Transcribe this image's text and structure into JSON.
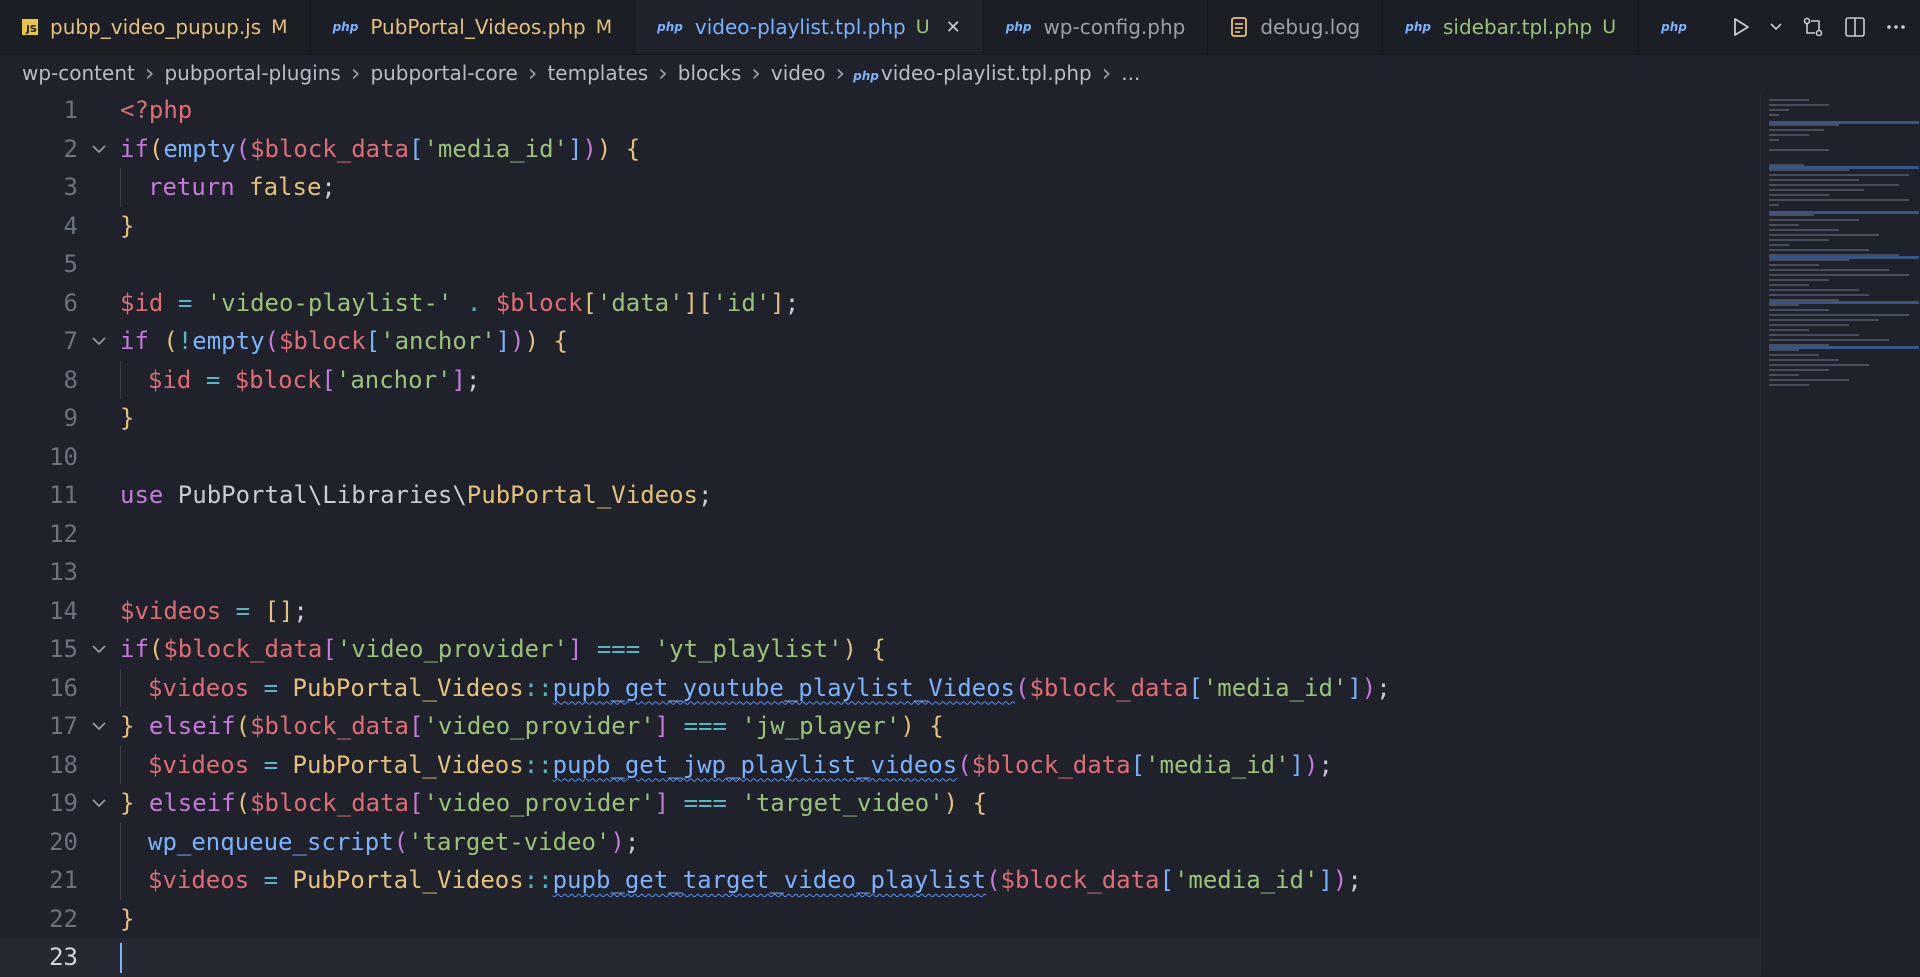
{
  "tabs": [
    {
      "label": "pubp_video_pupup.js",
      "modifier": "M",
      "icon": "js-icon",
      "color": "#e5c07b",
      "modcolor": "#e5c07b"
    },
    {
      "label": "PubPortal_Videos.php",
      "modifier": "M",
      "icon": "php-icon",
      "color": "#e5c07b",
      "modcolor": "#e5c07b"
    },
    {
      "label": "video-playlist.tpl.php",
      "modifier": "U",
      "icon": "php-icon",
      "color": "#7ab2ff",
      "modcolor": "#98c379",
      "active": true
    },
    {
      "label": "wp-config.php",
      "modifier": "",
      "icon": "php-icon",
      "color": "#9aa0aa",
      "modcolor": ""
    },
    {
      "label": "debug.log",
      "modifier": "",
      "icon": "log-icon",
      "color": "#9aa0aa",
      "modcolor": ""
    },
    {
      "label": "sidebar.tpl.php",
      "modifier": "U",
      "icon": "php-icon",
      "color": "#98c379",
      "modcolor": "#98c379"
    }
  ],
  "tab_actions": [
    "run-icon",
    "chevron-down-icon",
    "compare-changes-icon",
    "split-editor-icon",
    "more-actions-icon"
  ],
  "breadcrumb": [
    "wp-content",
    "pubportal-plugins",
    "pubportal-core",
    "templates",
    "blocks",
    "video",
    "video-playlist.tpl.php",
    "..."
  ],
  "editor": {
    "current_line": 23,
    "lines": [
      {
        "n": 1,
        "fold": false,
        "indent": 0,
        "tokens": [
          [
            "tag",
            "<?php"
          ]
        ]
      },
      {
        "n": 2,
        "fold": true,
        "indent": 0,
        "tokens": [
          [
            "kw",
            "if"
          ],
          [
            "br1",
            "("
          ],
          [
            "fn",
            "empty"
          ],
          [
            "br2",
            "("
          ],
          [
            "var",
            "$block_data"
          ],
          [
            "br3",
            "["
          ],
          [
            "str",
            "'media_id'"
          ],
          [
            "br3",
            "]"
          ],
          [
            "br2",
            ")"
          ],
          [
            "br1",
            ")"
          ],
          [
            "punc",
            " "
          ],
          [
            "br1",
            "{"
          ]
        ]
      },
      {
        "n": 3,
        "fold": false,
        "indent": 1,
        "tokens": [
          [
            "kw",
            "return"
          ],
          [
            "punc",
            " "
          ],
          [
            "cls",
            "false"
          ],
          [
            "punc",
            ";"
          ]
        ]
      },
      {
        "n": 4,
        "fold": false,
        "indent": 0,
        "tokens": [
          [
            "br1",
            "}"
          ]
        ]
      },
      {
        "n": 5,
        "fold": false,
        "indent": 0,
        "tokens": []
      },
      {
        "n": 6,
        "fold": false,
        "indent": 0,
        "tokens": [
          [
            "var",
            "$id"
          ],
          [
            "punc",
            " "
          ],
          [
            "op",
            "="
          ],
          [
            "punc",
            " "
          ],
          [
            "str",
            "'video-playlist-'"
          ],
          [
            "punc",
            " "
          ],
          [
            "op",
            "."
          ],
          [
            "punc",
            " "
          ],
          [
            "var",
            "$block"
          ],
          [
            "br1",
            "["
          ],
          [
            "str",
            "'data'"
          ],
          [
            "br1",
            "]"
          ],
          [
            "br1",
            "["
          ],
          [
            "str",
            "'id'"
          ],
          [
            "br1",
            "]"
          ],
          [
            "punc",
            ";"
          ]
        ]
      },
      {
        "n": 7,
        "fold": true,
        "indent": 0,
        "tokens": [
          [
            "kw",
            "if"
          ],
          [
            "punc",
            " "
          ],
          [
            "br1",
            "("
          ],
          [
            "op",
            "!"
          ],
          [
            "fn",
            "empty"
          ],
          [
            "br2",
            "("
          ],
          [
            "var",
            "$block"
          ],
          [
            "br3",
            "["
          ],
          [
            "str",
            "'anchor'"
          ],
          [
            "br3",
            "]"
          ],
          [
            "br2",
            ")"
          ],
          [
            "br1",
            ")"
          ],
          [
            "punc",
            " "
          ],
          [
            "br1",
            "{"
          ]
        ]
      },
      {
        "n": 8,
        "fold": false,
        "indent": 1,
        "tokens": [
          [
            "var",
            "$id"
          ],
          [
            "punc",
            " "
          ],
          [
            "op",
            "="
          ],
          [
            "punc",
            " "
          ],
          [
            "var",
            "$block"
          ],
          [
            "br2",
            "["
          ],
          [
            "str",
            "'anchor'"
          ],
          [
            "br2",
            "]"
          ],
          [
            "punc",
            ";"
          ]
        ]
      },
      {
        "n": 9,
        "fold": false,
        "indent": 0,
        "tokens": [
          [
            "br1",
            "}"
          ]
        ]
      },
      {
        "n": 10,
        "fold": false,
        "indent": 0,
        "tokens": []
      },
      {
        "n": 11,
        "fold": false,
        "indent": 0,
        "tokens": [
          [
            "kw",
            "use"
          ],
          [
            "punc",
            " PubPortal\\Libraries\\"
          ],
          [
            "cls",
            "PubPortal_Videos"
          ],
          [
            "punc",
            ";"
          ]
        ]
      },
      {
        "n": 12,
        "fold": false,
        "indent": 0,
        "tokens": []
      },
      {
        "n": 13,
        "fold": false,
        "indent": 0,
        "tokens": []
      },
      {
        "n": 14,
        "fold": false,
        "indent": 0,
        "tokens": [
          [
            "var",
            "$videos"
          ],
          [
            "punc",
            " "
          ],
          [
            "op",
            "="
          ],
          [
            "punc",
            " "
          ],
          [
            "br1",
            "[]"
          ],
          [
            "punc",
            ";"
          ]
        ]
      },
      {
        "n": 15,
        "fold": true,
        "indent": 0,
        "tokens": [
          [
            "kw",
            "if"
          ],
          [
            "br1",
            "("
          ],
          [
            "var",
            "$block_data"
          ],
          [
            "br2",
            "["
          ],
          [
            "str",
            "'video_provider'"
          ],
          [
            "br2",
            "]"
          ],
          [
            "punc",
            " "
          ],
          [
            "op",
            "==="
          ],
          [
            "punc",
            " "
          ],
          [
            "str",
            "'yt_playlist'"
          ],
          [
            "br1",
            ")"
          ],
          [
            "punc",
            " "
          ],
          [
            "br1",
            "{"
          ]
        ]
      },
      {
        "n": 16,
        "fold": false,
        "indent": 1,
        "tokens": [
          [
            "var",
            "$videos"
          ],
          [
            "punc",
            " "
          ],
          [
            "op",
            "="
          ],
          [
            "punc",
            " "
          ],
          [
            "cls",
            "PubPortal_Videos"
          ],
          [
            "op",
            "::"
          ],
          [
            "fn squig",
            "pupb_get_youtube_playlist_Videos"
          ],
          [
            "br2",
            "("
          ],
          [
            "var",
            "$block_data"
          ],
          [
            "br3",
            "["
          ],
          [
            "str",
            "'media_id'"
          ],
          [
            "br3",
            "]"
          ],
          [
            "br2",
            ")"
          ],
          [
            "punc",
            ";"
          ]
        ]
      },
      {
        "n": 17,
        "fold": true,
        "indent": 0,
        "tokens": [
          [
            "br1",
            "}"
          ],
          [
            "punc",
            " "
          ],
          [
            "kw",
            "elseif"
          ],
          [
            "br1",
            "("
          ],
          [
            "var",
            "$block_data"
          ],
          [
            "br2",
            "["
          ],
          [
            "str",
            "'video_provider'"
          ],
          [
            "br2",
            "]"
          ],
          [
            "punc",
            " "
          ],
          [
            "op",
            "==="
          ],
          [
            "punc",
            " "
          ],
          [
            "str",
            "'jw_player'"
          ],
          [
            "br1",
            ")"
          ],
          [
            "punc",
            " "
          ],
          [
            "br1",
            "{"
          ]
        ]
      },
      {
        "n": 18,
        "fold": false,
        "indent": 1,
        "tokens": [
          [
            "var",
            "$videos"
          ],
          [
            "punc",
            " "
          ],
          [
            "op",
            "="
          ],
          [
            "punc",
            " "
          ],
          [
            "cls",
            "PubPortal_Videos"
          ],
          [
            "op",
            "::"
          ],
          [
            "fn squig",
            "pupb_get_jwp_playlist_videos"
          ],
          [
            "br2",
            "("
          ],
          [
            "var",
            "$block_data"
          ],
          [
            "br3",
            "["
          ],
          [
            "str",
            "'media_id'"
          ],
          [
            "br3",
            "]"
          ],
          [
            "br2",
            ")"
          ],
          [
            "punc",
            ";"
          ]
        ]
      },
      {
        "n": 19,
        "fold": true,
        "indent": 0,
        "tokens": [
          [
            "br1",
            "}"
          ],
          [
            "punc",
            " "
          ],
          [
            "kw",
            "elseif"
          ],
          [
            "br1",
            "("
          ],
          [
            "var",
            "$block_data"
          ],
          [
            "br2",
            "["
          ],
          [
            "str",
            "'video_provider'"
          ],
          [
            "br2",
            "]"
          ],
          [
            "punc",
            " "
          ],
          [
            "op",
            "==="
          ],
          [
            "punc",
            " "
          ],
          [
            "str",
            "'target_video'"
          ],
          [
            "br1",
            ")"
          ],
          [
            "punc",
            " "
          ],
          [
            "br1",
            "{"
          ]
        ]
      },
      {
        "n": 20,
        "fold": false,
        "indent": 1,
        "tokens": [
          [
            "fn",
            "wp_enqueue_script"
          ],
          [
            "br2",
            "("
          ],
          [
            "str",
            "'target-video'"
          ],
          [
            "br2",
            ")"
          ],
          [
            "punc",
            ";"
          ]
        ]
      },
      {
        "n": 21,
        "fold": false,
        "indent": 1,
        "tokens": [
          [
            "var",
            "$videos"
          ],
          [
            "punc",
            " "
          ],
          [
            "op",
            "="
          ],
          [
            "punc",
            " "
          ],
          [
            "cls",
            "PubPortal_Videos"
          ],
          [
            "op",
            "::"
          ],
          [
            "fn squig",
            "pupb_get_target_video_playlist"
          ],
          [
            "br2",
            "("
          ],
          [
            "var",
            "$block_data"
          ],
          [
            "br3",
            "["
          ],
          [
            "str",
            "'media_id'"
          ],
          [
            "br3",
            "]"
          ],
          [
            "br2",
            ")"
          ],
          [
            "punc",
            ";"
          ]
        ]
      },
      {
        "n": 22,
        "fold": false,
        "indent": 0,
        "tokens": [
          [
            "br1",
            "}"
          ]
        ]
      },
      {
        "n": 23,
        "fold": false,
        "indent": 0,
        "tokens": []
      }
    ]
  }
}
